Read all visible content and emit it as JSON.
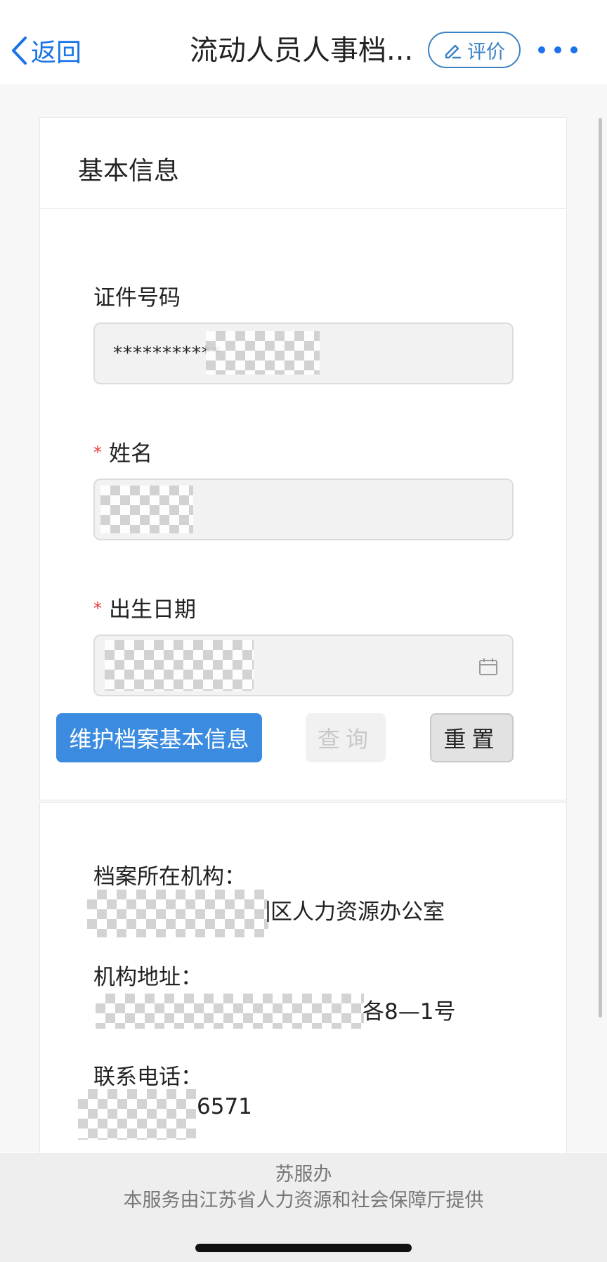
{
  "nav": {
    "back_label": "返回",
    "title": "流动人员人事档...",
    "rate_label": "评价"
  },
  "card_basic": {
    "title": "基本信息"
  },
  "form": {
    "id_label": "证件号码",
    "id_value": "***********",
    "name_label": "姓名",
    "dob_label": "出生日期",
    "required_mark": "*"
  },
  "buttons": {
    "maintain": "维护档案基本信息",
    "query": "查询",
    "reset": "重置"
  },
  "result": {
    "org_label": "档案所在机构：",
    "org_value_visible": "区人力资源办公室",
    "address_label": "机构地址：",
    "address_value_visible": "各8—1号",
    "phone_label": "联系电话：",
    "phone_value_visible": "6571"
  },
  "footer": {
    "name": "苏服办",
    "description": "本服务由江苏省人力资源和社会保障厅提供"
  },
  "colors": {
    "accent": "#1a73e8",
    "primary_button": "#3b8be0",
    "required": "#e4393c"
  }
}
